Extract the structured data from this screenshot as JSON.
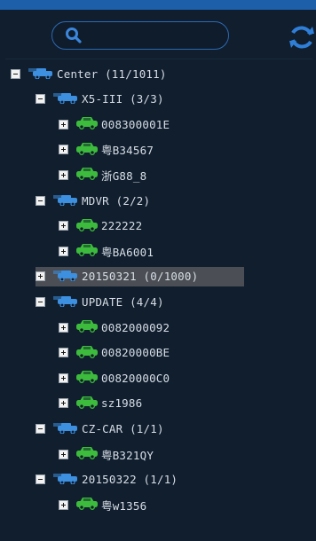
{
  "colors": {
    "accent": "#2c6ab3",
    "group_icon": "#3d8fe0",
    "vehicle_icon": "#3dbb3d",
    "selected_bg": "#4b4f55"
  },
  "search": {
    "icon": "search-icon"
  },
  "refresh": {
    "icon": "refresh-icon"
  },
  "tree": [
    {
      "label": "Center (11/1011)",
      "type": "group",
      "toggle": "minus",
      "level": 0
    },
    {
      "label": "X5-III (3/3)",
      "type": "group",
      "toggle": "minus",
      "level": 1
    },
    {
      "label": "008300001E",
      "type": "vehicle",
      "toggle": "plus",
      "level": 2
    },
    {
      "label": "粤B34567",
      "type": "vehicle",
      "toggle": "plus",
      "level": 2
    },
    {
      "label": "浙G88_8",
      "type": "vehicle",
      "toggle": "plus",
      "level": 2
    },
    {
      "label": "MDVR (2/2)",
      "type": "group",
      "toggle": "minus",
      "level": 1
    },
    {
      "label": "222222",
      "type": "vehicle",
      "toggle": "plus",
      "level": 2
    },
    {
      "label": "粤BA6001",
      "type": "vehicle",
      "toggle": "plus",
      "level": 2
    },
    {
      "label": "20150321 (0/1000)",
      "type": "group",
      "toggle": "plus",
      "level": 1,
      "selected": true
    },
    {
      "label": "UPDATE (4/4)",
      "type": "group",
      "toggle": "minus",
      "level": 1
    },
    {
      "label": "0082000092",
      "type": "vehicle",
      "toggle": "plus",
      "level": 2
    },
    {
      "label": "00820000BE",
      "type": "vehicle",
      "toggle": "plus",
      "level": 2
    },
    {
      "label": "00820000C0",
      "type": "vehicle",
      "toggle": "plus",
      "level": 2
    },
    {
      "label": "sz1986",
      "type": "vehicle",
      "toggle": "plus",
      "level": 2
    },
    {
      "label": "CZ-CAR (1/1)",
      "type": "group",
      "toggle": "minus",
      "level": 1
    },
    {
      "label": "粤B321QY",
      "type": "vehicle",
      "toggle": "plus",
      "level": 2
    },
    {
      "label": "20150322 (1/1)",
      "type": "group",
      "toggle": "minus",
      "level": 1
    },
    {
      "label": "粤w1356",
      "type": "vehicle",
      "toggle": "plus",
      "level": 2
    }
  ]
}
